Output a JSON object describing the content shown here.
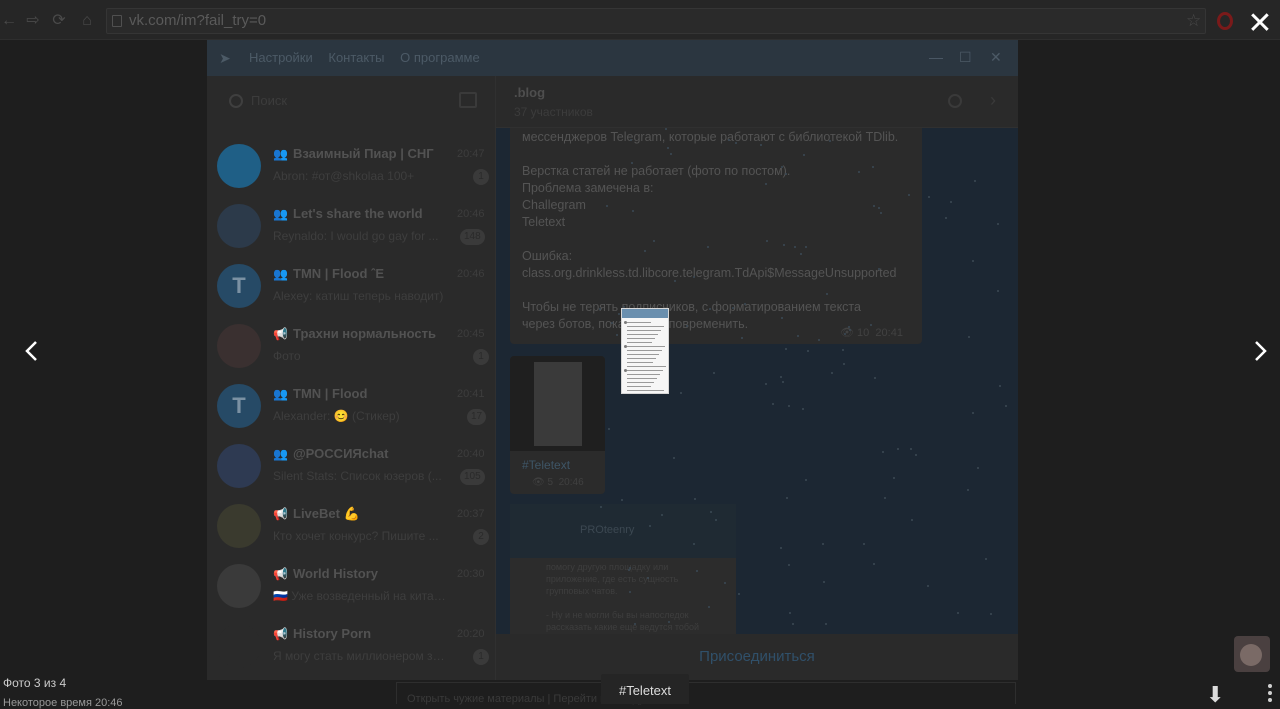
{
  "browser": {
    "url": "vk.com/im?fail_try=0"
  },
  "telegram": {
    "menu": [
      "Настройки",
      "Контакты",
      "О программе"
    ],
    "search_placeholder": "Поиск",
    "chats": [
      {
        "type": "group",
        "name": "Взаимный Пиар | СНГ",
        "time": "20:47",
        "preview": "Abron: #от@shkolaa 100+",
        "badge": "1",
        "avatar_color": "#1f5f86",
        "letter": ""
      },
      {
        "type": "group",
        "name": "Let's share the world",
        "time": "20:46",
        "preview": "Reynaldo: I would go gay for ...",
        "badge": "148",
        "avatar_color": "#2c3a4a",
        "letter": ""
      },
      {
        "type": "group",
        "name": "TMN | Flood ˆЕ",
        "time": "20:46",
        "preview": "Alexey: катиш теперь наводит)",
        "badge": "",
        "avatar_color": "#264a66",
        "letter": "T"
      },
      {
        "type": "channel",
        "name": "Трахни нормальность",
        "time": "20:45",
        "preview": "Фото",
        "badge": "1",
        "avatar_color": "#3a3030",
        "letter": ""
      },
      {
        "type": "group",
        "name": "TMN | Flood",
        "time": "20:41",
        "preview": "Alexander: 😊 (Стикер)",
        "badge": "17",
        "avatar_color": "#264a66",
        "letter": "T"
      },
      {
        "type": "group",
        "name": "@РОССИЯchat",
        "time": "20:40",
        "preview": "Silent Stats: Список юзеров (...",
        "badge": "105",
        "avatar_color": "#2e3a52",
        "letter": ""
      },
      {
        "type": "channel",
        "name": "LiveBet 💪",
        "time": "20:37",
        "preview": "Кто хочет конкурс? Пишите ...",
        "badge": "2",
        "avatar_color": "#3a3a2e",
        "letter": ""
      },
      {
        "type": "channel",
        "name": "World History",
        "time": "20:30",
        "preview": "🇷🇺 Уже возведенный на китайском...",
        "badge": "",
        "avatar_color": "#3a3a3a",
        "letter": ""
      },
      {
        "type": "channel",
        "name": "History Porn",
        "time": "20:20",
        "preview": "Я могу стать миллионером за ...",
        "badge": "1",
        "avatar_color": "#2a2a2a",
        "letter": ""
      }
    ],
    "active_chat": {
      "title": ".blog",
      "subtitle": "37 участников",
      "message_lines": [
        "мессенджеров Telegram, которые работают с библиотекой TDlib.",
        "",
        "Верстка статей не работает (фото по постом).",
        "Проблема замечена в:",
        "Challegram",
        "Teletext",
        "",
        "Ошибка:",
        "class.org.drinkless.td.libcore.telegram.TdApi$MessageUnsupported",
        "",
        "Чтобы не терять подписчиков, с форматированием текста",
        "через ботов, пока лучше повременить."
      ],
      "message_views": "10",
      "message_time": "20:41",
      "photo_tag": "#Teletext",
      "photo_views": "5",
      "photo_time": "20:46",
      "screenshot_title": "PROteenry",
      "screenshot_lines": [
        "помогу другую площадку или",
        "приложение, где есть сущность",
        "групповых чатов.",
        "",
        "- Ну и не могли бы вы напоследок",
        "рассказать какие еще ведутся тобой",
        "проекты, над которыми работаете"
      ],
      "join_label": "Присоединиться"
    }
  },
  "viewer": {
    "counter": "Фото 3 из 4",
    "date_line": "Некоторое время 20:46",
    "caption": "#Teletext",
    "below_text": "Открыть чужие материалы | Перейти в беседу"
  }
}
